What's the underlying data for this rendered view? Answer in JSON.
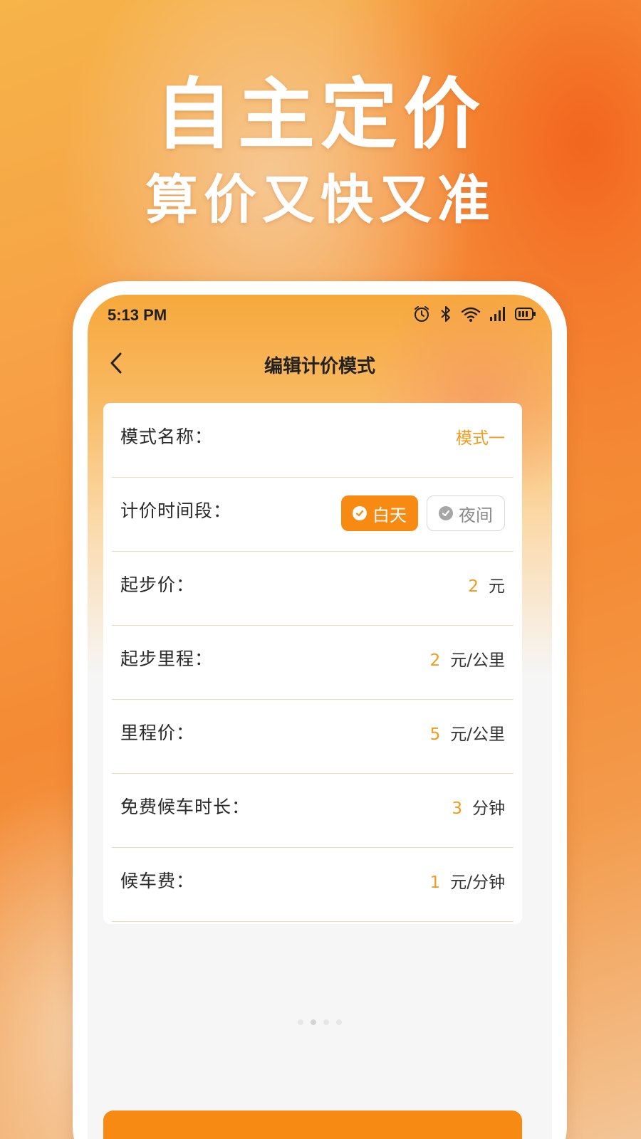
{
  "hero": {
    "title": "自主定价",
    "subtitle": "算价又快又准"
  },
  "status_bar": {
    "time": "5:13 PM",
    "icons": [
      "alarm-icon",
      "bluetooth-icon",
      "wifi-icon",
      "signal-icon",
      "battery-icon"
    ]
  },
  "nav": {
    "title": "编辑计价模式",
    "back_icon": "chevron-left-icon"
  },
  "form": {
    "mode_name": {
      "label": "模式名称：",
      "value": "模式一"
    },
    "time_period": {
      "label": "计价时间段：",
      "options": [
        {
          "label": "白天",
          "selected": true
        },
        {
          "label": "夜间",
          "selected": false
        }
      ]
    },
    "start_price": {
      "label": "起步价：",
      "value": "2",
      "unit": "元"
    },
    "start_mileage": {
      "label": "起步里程：",
      "value": "2",
      "unit": "元/公里"
    },
    "mileage_price": {
      "label": "里程价：",
      "value": "5",
      "unit": "元/公里"
    },
    "free_wait": {
      "label": "免费候车时长：",
      "value": "3",
      "unit": "分钟"
    },
    "wait_fee": {
      "label": "候车费：",
      "value": "1",
      "unit": "元/分钟"
    }
  },
  "colors": {
    "accent": "#f78a12",
    "value": "#f39a1a",
    "divider": "#ecd9b8"
  }
}
